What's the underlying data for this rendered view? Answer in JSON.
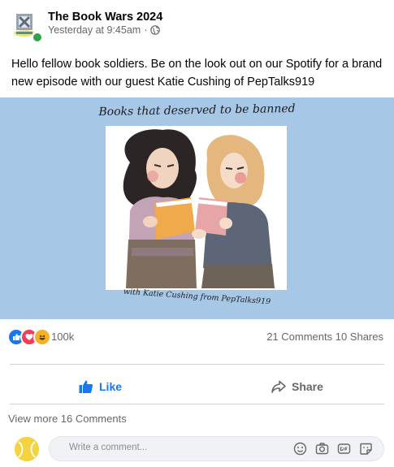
{
  "post": {
    "page_name": "The Book Wars 2024",
    "timestamp": "Yesterday at 9:45am",
    "separator": "·",
    "audience_icon": "globe-icon",
    "text": "Hello fellow book soldiers. Be on the look out on our Spotify for a brand new episode with our guest Katie Cushing of PepTalks919"
  },
  "media": {
    "title": "Books that deserved to be banned",
    "caption": "with Katie Cushing from PepTalks919",
    "background_color": "#a7c7e7"
  },
  "stats": {
    "reactions": [
      "like-icon",
      "love-icon",
      "haha-icon"
    ],
    "reaction_count": "100k",
    "comments": "21 Comments",
    "shares": "10 Shares"
  },
  "actions": {
    "like_label": "Like",
    "share_label": "Share"
  },
  "comments": {
    "view_more": "View more 16 Comments",
    "placeholder": "Write a comment...",
    "tools": [
      "emoji-icon",
      "camera-icon",
      "gif-icon",
      "sticker-icon"
    ]
  },
  "colors": {
    "accent": "#1877f2",
    "online": "#31a24c",
    "secondary_text": "#65676b"
  }
}
